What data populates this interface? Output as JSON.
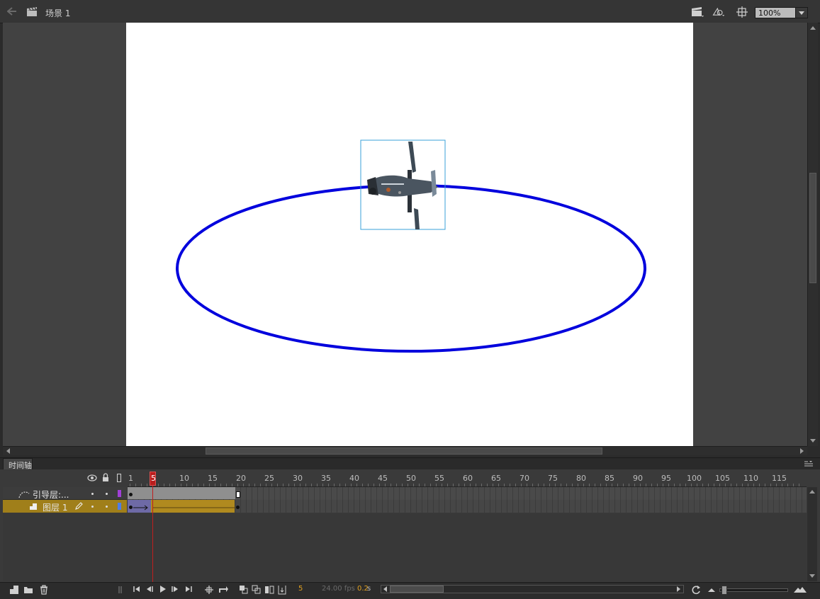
{
  "editbar": {
    "scene_label": "场景 1",
    "zoom_value": "100%",
    "icons": [
      "back-arrow-icon",
      "clapperboard-icon",
      "edit-scene-icon",
      "edit-symbol-icon",
      "center-stage-icon"
    ]
  },
  "stage": {
    "background": "#ffffff",
    "guide_color": "#0000dd",
    "selection_color": "#3aa0d8"
  },
  "timeline": {
    "tab_label": "时间轴",
    "ruler_numbers": [
      "1",
      "5",
      "10",
      "15",
      "20",
      "25",
      "30",
      "35",
      "40",
      "45",
      "50",
      "55",
      "60",
      "65",
      "70",
      "75",
      "80",
      "85",
      "90",
      "95",
      "100",
      "105",
      "110",
      "115"
    ],
    "current_frame_marker": "5",
    "layers": [
      {
        "name": "引导层:...",
        "color": "#a13fd6",
        "type": "guide"
      },
      {
        "name": "图层 1",
        "color": "#4d7de8",
        "type": "normal",
        "selected": true
      }
    ]
  },
  "status": {
    "current_frame": "5",
    "fps": "24.00 fps",
    "time_value": "0.2",
    "time_unit": "s"
  },
  "colors": {
    "selected_layer": "#a07f1a",
    "tween_span": "#b08a1f",
    "playhead": "#c01e1e"
  }
}
